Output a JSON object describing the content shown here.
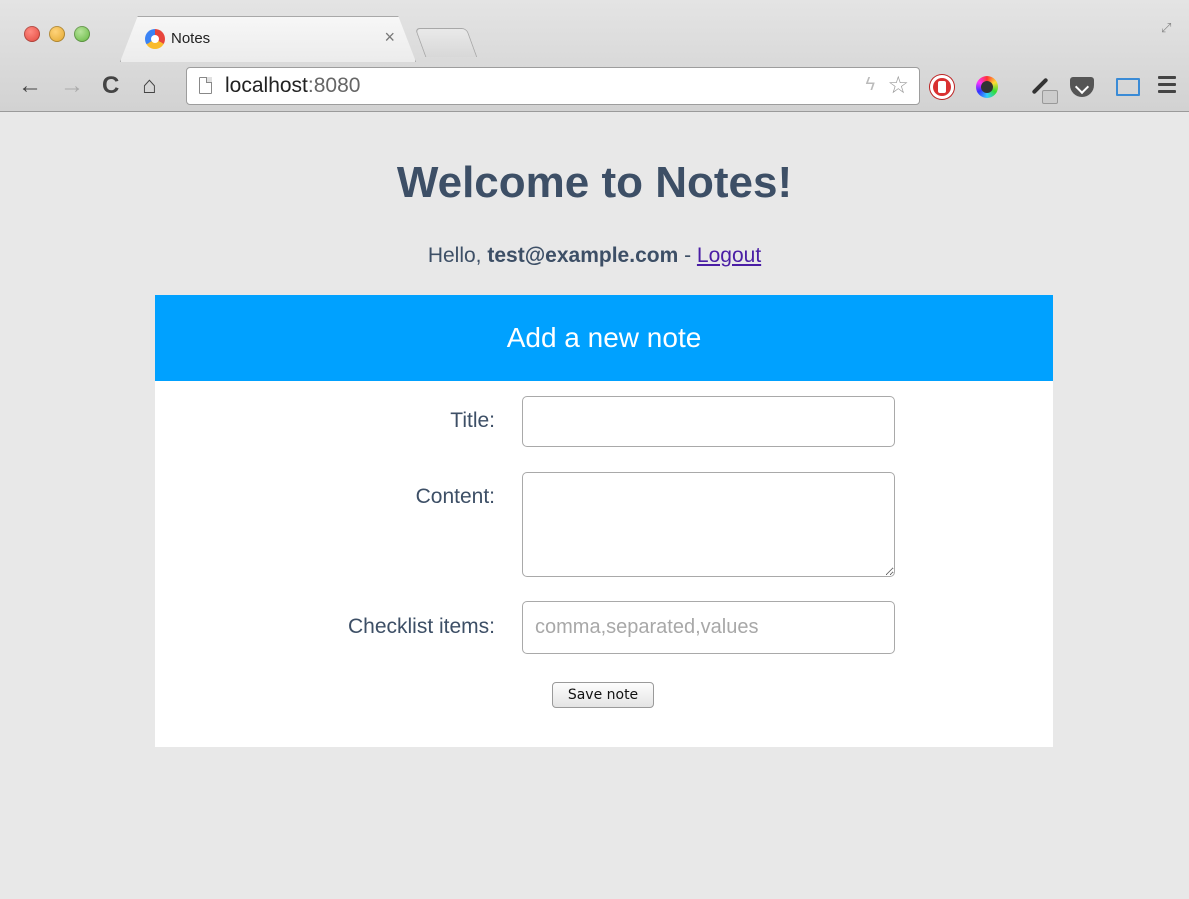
{
  "browser": {
    "tab_title": "Notes",
    "tab_close": "×",
    "url_host": "localhost",
    "url_port": ":8080",
    "icons": [
      "back-arrow-icon",
      "forward-arrow-icon",
      "reload-icon",
      "home-icon",
      "page-icon",
      "bolt-icon",
      "star-icon",
      "adblock-icon",
      "color-picker-icon",
      "eyedropper-icon",
      "pocket-icon",
      "window-icon",
      "menu-icon"
    ]
  },
  "page": {
    "title": "Welcome to Notes!",
    "greeting_prefix": "Hello, ",
    "user_email": "test@example.com",
    "greeting_sep": " - ",
    "logout_label": "Logout"
  },
  "form": {
    "header": "Add a new note",
    "title_label": "Title:",
    "title_value": "",
    "content_label": "Content:",
    "content_value": "",
    "checklist_label": "Checklist items:",
    "checklist_placeholder": "comma,separated,values",
    "save_label": "Save note"
  },
  "colors": {
    "header_bg": "#00a1ff",
    "text": "#3d4f66",
    "page_bg": "#e8e8e8",
    "link": "#4a1ea5"
  }
}
